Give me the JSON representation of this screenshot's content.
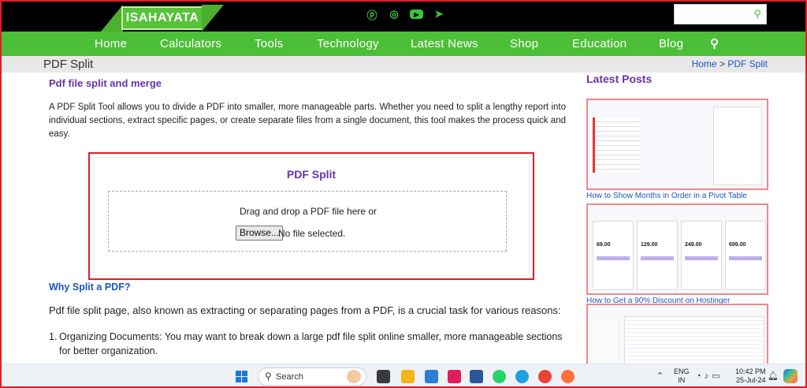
{
  "header": {
    "logo_text": "ISAHAYATA",
    "search_placeholder": "",
    "social_icons": [
      "pinterest-icon",
      "instagram-icon",
      "youtube-icon",
      "telegram-icon"
    ]
  },
  "nav": {
    "items": [
      "Home",
      "Calculators",
      "Tools",
      "Technology",
      "Latest News",
      "Shop",
      "Education",
      "Blog"
    ]
  },
  "titlebar": {
    "page_title": "PDF Split",
    "breadcrumb_home": "Home",
    "breadcrumb_sep": ">",
    "breadcrumb_current": "PDF Split"
  },
  "main": {
    "heading": "Pdf file split and merge",
    "intro": "A PDF Split Tool allows you to divide a PDF into smaller, more manageable parts. Whether you need to split a lengthy report into individual sections, extract specific pages, or create separate files from a single document, this tool makes the process quick and easy.",
    "tool": {
      "title": "PDF Split",
      "drop_text": "Drag and drop a PDF file here or",
      "browse_label": "Browse...",
      "no_file_text": "No file selected."
    },
    "why_heading": "Why Split a PDF?",
    "why_text": "Pdf file split page, also known as extracting or separating pages from a PDF, is a crucial task for various reasons:",
    "list": [
      {
        "num": "1.",
        "text": "Organizing Documents: You may want to break down a large pdf file split online smaller, more manageable sections for better organization."
      }
    ]
  },
  "sidebar": {
    "heading": "Latest Posts",
    "posts": [
      {
        "title": "How to Show Months in Order in a Pivot Table"
      },
      {
        "title": "How to Get a 90% Discount on Hostinger"
      }
    ],
    "hostinger_prices": [
      "69.00",
      "129.00",
      "249.00",
      "699.00"
    ]
  },
  "taskbar": {
    "search_label": "Search",
    "lang_top": "ENG",
    "lang_bottom": "IN",
    "time": "10:42 PM",
    "date": "25-Jul-24"
  },
  "colors": {
    "brand_green": "#4cbe37",
    "heading_purple": "#6633aa",
    "link_blue": "#1a56c8",
    "highlight_red": "#e11d23"
  }
}
